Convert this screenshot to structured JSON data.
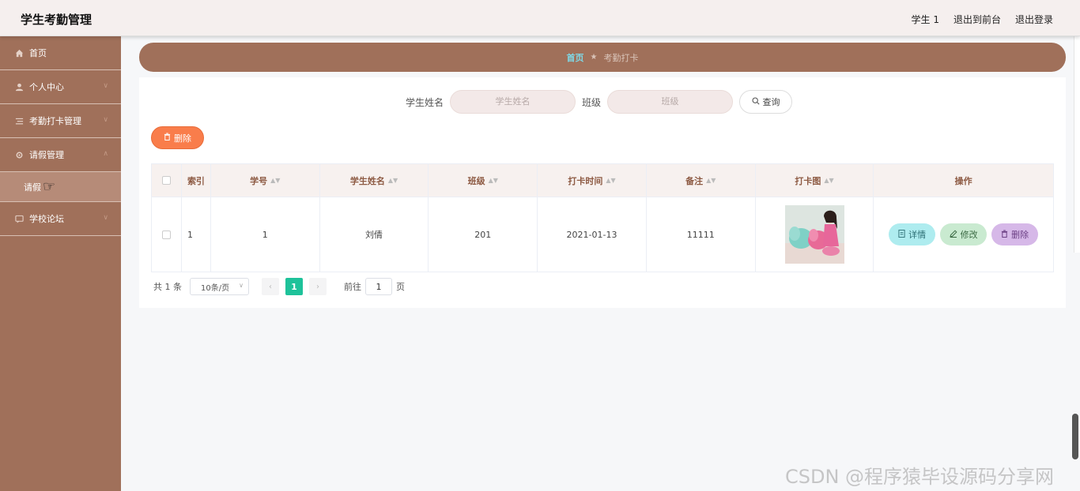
{
  "header": {
    "app_title": "学生考勤管理",
    "links": [
      "学生 1",
      "退出到前台",
      "退出登录"
    ]
  },
  "sidebar": {
    "items": [
      {
        "label": "首页",
        "icon": "home-icon"
      },
      {
        "label": "个人中心",
        "icon": "user-icon"
      },
      {
        "label": "考勤打卡管理",
        "icon": "list-icon"
      },
      {
        "label": "请假管理",
        "icon": "gear-icon"
      },
      {
        "label": "学校论坛",
        "icon": "chat-icon"
      }
    ],
    "submenu_label": "请假"
  },
  "breadcrumb": {
    "home": "首页",
    "current": "考勤打卡"
  },
  "search": {
    "name_label": "学生姓名",
    "name_placeholder": "学生姓名",
    "class_label": "班级",
    "class_placeholder": "班级",
    "query_label": "查询"
  },
  "toolbar": {
    "delete_label": "删除"
  },
  "table": {
    "headers": [
      "索引",
      "学号",
      "学生姓名",
      "班级",
      "打卡时间",
      "备注",
      "打卡图",
      "操作"
    ],
    "rows": [
      {
        "index": "1",
        "student_id": "1",
        "name": "刘倩",
        "class": "201",
        "time": "2021-01-13",
        "note": "11111"
      }
    ],
    "actions": {
      "detail": "详情",
      "edit": "修改",
      "delete": "删除"
    }
  },
  "pagination": {
    "total": "共 1 条",
    "page_size": "10条/页",
    "current_page": "1",
    "goto_prefix": "前往",
    "goto_value": "1",
    "goto_suffix": "页"
  },
  "watermark": "CSDN @程序猿毕设源码分享网",
  "colors": {
    "sidebar": "#a0705a",
    "accent": "#1ec29a",
    "delete_button": "#f97d4b"
  }
}
